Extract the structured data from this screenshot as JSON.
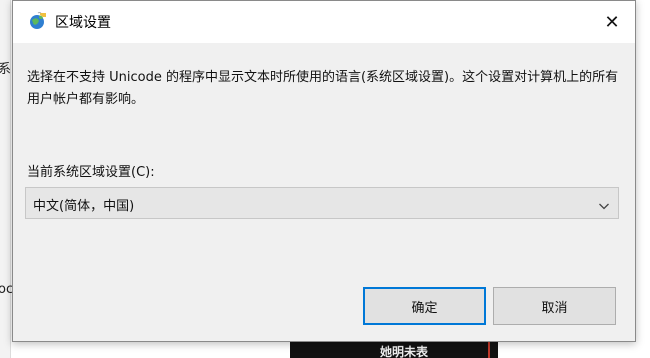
{
  "background": {
    "left_text_1": "系",
    "left_text_2": "oc",
    "dark_strip_text": "她明未表"
  },
  "dialog": {
    "title": "区域设置",
    "close_symbol": "✕",
    "description": "选择在不支持 Unicode 的程序中显示文本时所使用的语言(系统区域设置)。这个设置对计算机上的所有用户帐户都有影响。",
    "current_label": "当前系统区域设置(C):",
    "current_value": "中文(简体，中国)",
    "ok_label": "确定",
    "cancel_label": "取消"
  },
  "colors": {
    "accent": "#0078d7",
    "dialog_bg": "#f0f0f0",
    "titlebar_bg": "#ffffff"
  },
  "icons": {
    "app": "region-globe-icon",
    "close": "close-icon",
    "dropdown": "chevron-down-icon"
  }
}
